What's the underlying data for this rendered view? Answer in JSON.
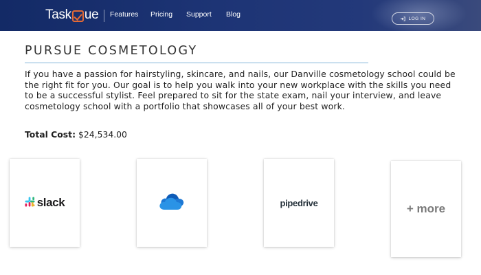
{
  "nav": {
    "logo_text_pre": "Task",
    "logo_text_post": "ue",
    "links": [
      "Features",
      "Pricing",
      "Support",
      "Blog"
    ],
    "login_label": "LOG IN"
  },
  "main": {
    "heading": "PURSUE COSMETOLOGY",
    "description": "If you have a passion for hairstyling, skincare, and nails, our Danville cosmetology school could be the right fit for you. Our goal is to help you walk into your new workplace with the skills you need to be a successful stylist. Feel prepared to sit for the state exam, nail your interview, and leave cosmetology school with a portfolio that showcases all of your best work.",
    "total_label": "Total Cost:",
    "total_value": "$24,534.00"
  },
  "integrations": [
    {
      "name": "slack",
      "label": "slack"
    },
    {
      "name": "onedrive",
      "label": ""
    },
    {
      "name": "pipedrive",
      "label": "pipedrive"
    },
    {
      "name": "more",
      "label": "+ more"
    }
  ],
  "colors": {
    "nav_bg": "#1d3475",
    "logo_accent": "#e46a35",
    "rule": "#7fb3d8",
    "text": "#1f1f1f"
  },
  "icons": [
    "check-icon",
    "login-icon",
    "slack-icon",
    "onedrive-cloud-icon"
  ]
}
